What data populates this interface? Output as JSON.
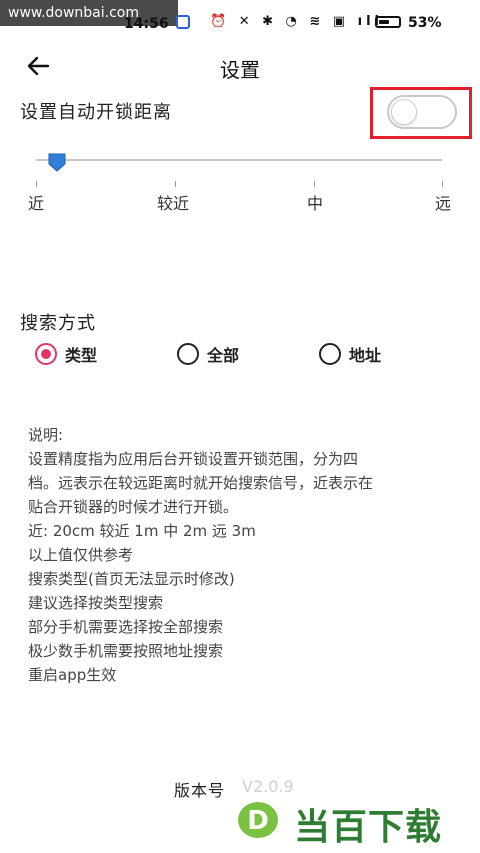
{
  "watermark_top": "www.downbai.com",
  "status_bar": {
    "time": "14:56",
    "icons_text": "⏰ ✕ ✱ ◔ ≋ ▣ ıll",
    "battery_level": 0.53,
    "battery_percent": "53%"
  },
  "header": {
    "back_icon": "arrow-left-icon",
    "title": "设置"
  },
  "auto_unlock": {
    "label": "设置自动开锁距离",
    "enabled": false,
    "highlight_color": "#e0202a"
  },
  "distance_slider": {
    "value_index": 0,
    "labels": [
      "近",
      "较近",
      "中",
      "远"
    ],
    "thumb_color": "#2f7fd9"
  },
  "search_mode": {
    "title": "搜索方式",
    "options": [
      {
        "label": "类型",
        "selected": true
      },
      {
        "label": "全部",
        "selected": false
      },
      {
        "label": "地址",
        "selected": false
      }
    ],
    "selected_color": "#e0356a"
  },
  "description": {
    "lines": [
      "说明:",
      " 设置精度指为应用后台开锁设置开锁范围，分为四",
      "档。远表示在较远距离时就开始搜索信号，近表示在",
      "贴合开锁器的时候才进行开锁。",
      " 近: 20cm 较近 1m 中 2m 远 3m",
      " 以上值仅供参考",
      " 搜索类型(首页无法显示时修改)",
      " 建议选择按类型搜索",
      " 部分手机需要选择按全部搜索",
      " 极少数手机需要按照地址搜索",
      " 重启app生效"
    ]
  },
  "version": {
    "label": "版本号",
    "value": "V2.0.9"
  },
  "watermark_logo": {
    "letter": "D",
    "text": "当百下载",
    "color": "#2e7d32"
  }
}
